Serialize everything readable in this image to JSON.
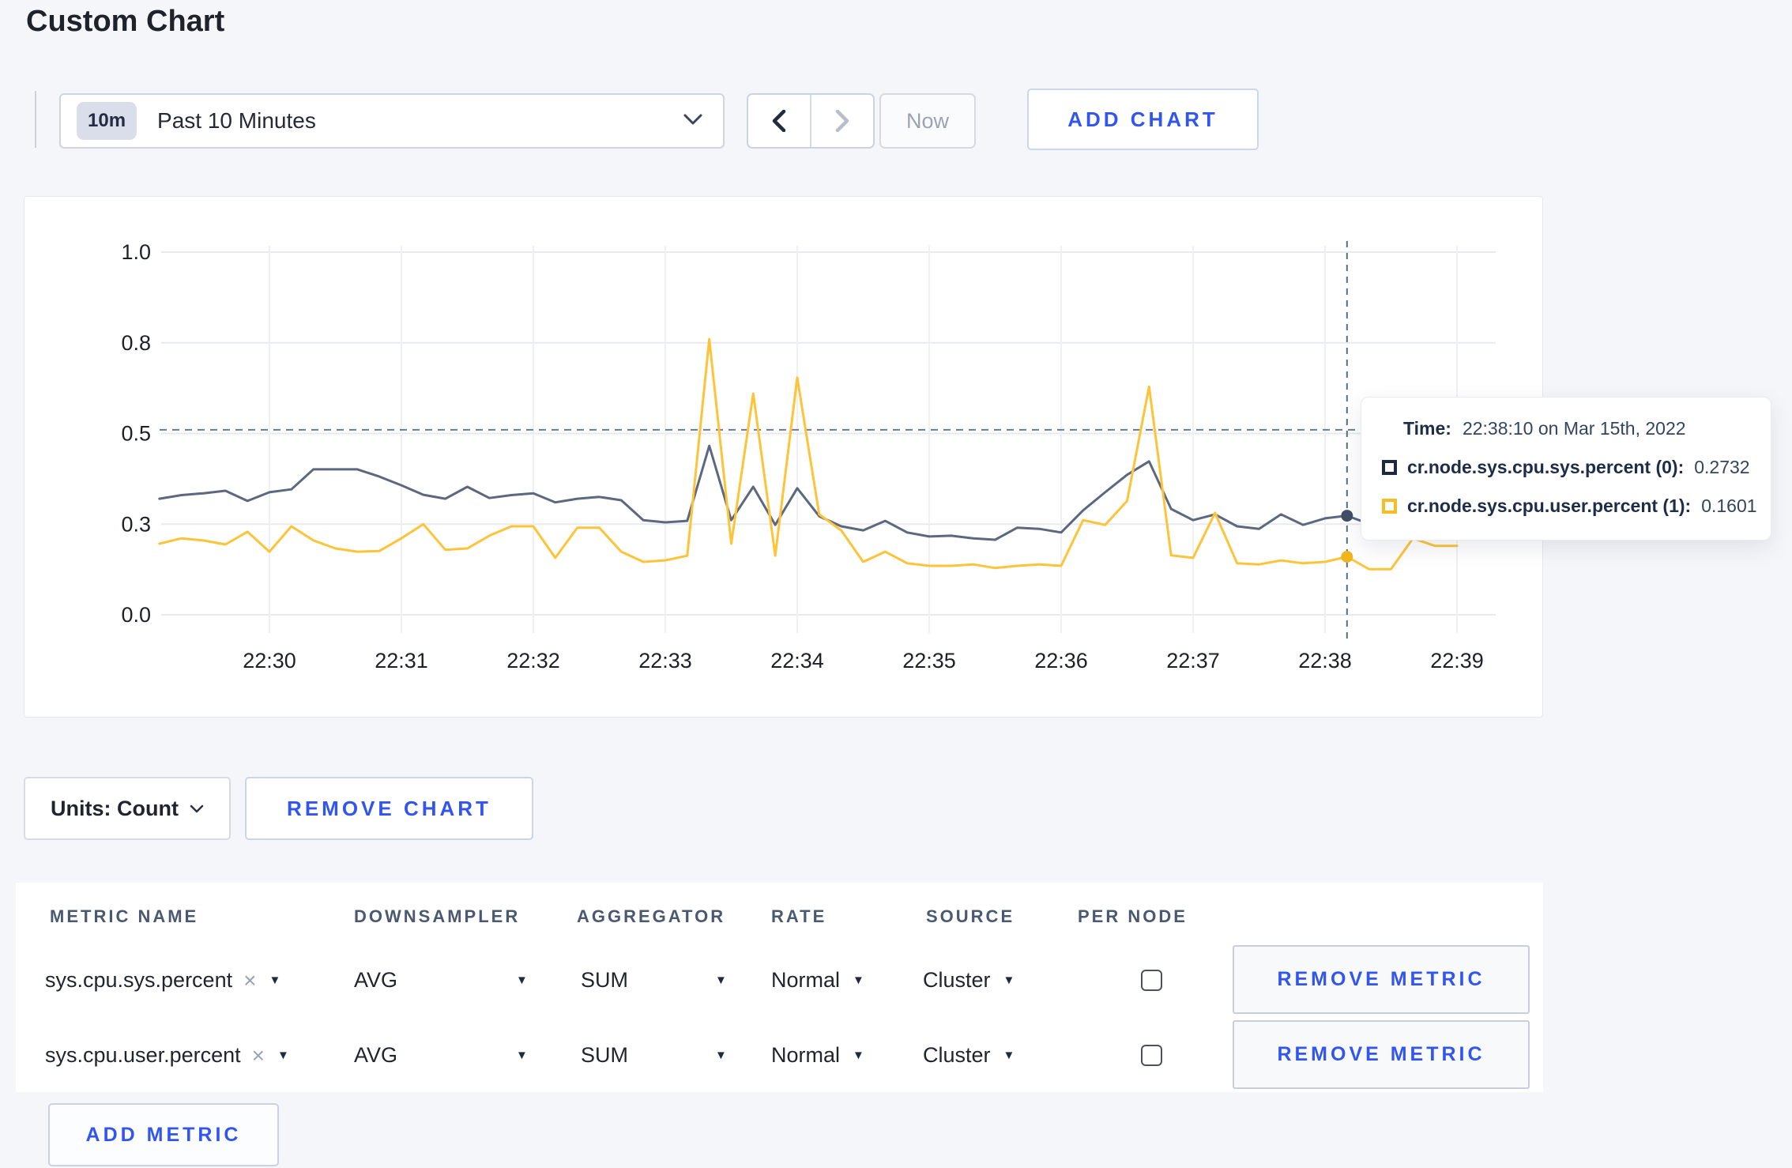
{
  "page": {
    "title": "Custom Chart",
    "accent_blue": "#3155ee",
    "background": "#f5f6fa"
  },
  "toolbar": {
    "time_badge": "10m",
    "time_label": "Past 10 Minutes",
    "now_label": "Now",
    "add_chart_label": "ADD CHART"
  },
  "chart_data": {
    "type": "line",
    "title": "",
    "xlabel": "",
    "ylabel": "",
    "ylim": [
      0,
      1
    ],
    "grid": true,
    "x_seconds_start": 10,
    "x_seconds_step": 10,
    "x_ticks": [
      {
        "seconds": 60,
        "label": "22:30"
      },
      {
        "seconds": 120,
        "label": "22:31"
      },
      {
        "seconds": 180,
        "label": "22:32"
      },
      {
        "seconds": 240,
        "label": "22:33"
      },
      {
        "seconds": 300,
        "label": "22:34"
      },
      {
        "seconds": 360,
        "label": "22:35"
      },
      {
        "seconds": 420,
        "label": "22:36"
      },
      {
        "seconds": 480,
        "label": "22:37"
      },
      {
        "seconds": 540,
        "label": "22:38"
      },
      {
        "seconds": 600,
        "label": "22:39"
      }
    ],
    "y_ticks": [
      {
        "value": 0,
        "label": "0.0"
      },
      {
        "value": 0.25,
        "label": "0.3"
      },
      {
        "value": 0.5,
        "label": "0.5"
      },
      {
        "value": 0.75,
        "label": "0.8"
      },
      {
        "value": 1,
        "label": "1.0"
      }
    ],
    "series": [
      {
        "name": "cr.node.sys.cpu.sys.percent",
        "color": "#5b6880",
        "dot_color": "#414e68",
        "values": [
          0.32,
          0.33,
          0.335,
          0.342,
          0.314,
          0.338,
          0.346,
          0.401,
          0.401,
          0.401,
          0.381,
          0.357,
          0.331,
          0.32,
          0.353,
          0.322,
          0.33,
          0.335,
          0.31,
          0.32,
          0.325,
          0.316,
          0.261,
          0.255,
          0.259,
          0.466,
          0.261,
          0.353,
          0.248,
          0.349,
          0.272,
          0.244,
          0.233,
          0.259,
          0.227,
          0.216,
          0.218,
          0.211,
          0.207,
          0.24,
          0.237,
          0.227,
          0.288,
          0.338,
          0.386,
          0.423,
          0.292,
          0.261,
          0.277,
          0.244,
          0.237,
          0.277,
          0.248,
          0.266,
          0.2732,
          0.251,
          0.247,
          0.252,
          0.262,
          0.27
        ]
      },
      {
        "name": "cr.node.sys.cpu.user.percent",
        "color": "#fdc43a",
        "dot_color": "#f0b41f",
        "values": [
          0.196,
          0.211,
          0.205,
          0.194,
          0.229,
          0.174,
          0.244,
          0.205,
          0.183,
          0.174,
          0.176,
          0.211,
          0.25,
          0.179,
          0.183,
          0.218,
          0.244,
          0.244,
          0.157,
          0.24,
          0.24,
          0.174,
          0.146,
          0.15,
          0.163,
          0.76,
          0.196,
          0.61,
          0.163,
          0.654,
          0.277,
          0.233,
          0.146,
          0.174,
          0.142,
          0.135,
          0.135,
          0.139,
          0.129,
          0.135,
          0.139,
          0.135,
          0.261,
          0.248,
          0.314,
          0.629,
          0.164,
          0.157,
          0.281,
          0.142,
          0.139,
          0.15,
          0.142,
          0.146,
          0.1601,
          0.126,
          0.126,
          0.211,
          0.19,
          0.19
        ]
      }
    ],
    "hover": {
      "x_seconds": 550,
      "guide_value": 0.51
    },
    "legend_position": "tooltip"
  },
  "tooltip": {
    "time_label": "Time:",
    "time_value": "22:38:10 on Mar 15th, 2022",
    "rows": [
      {
        "name": "cr.node.sys.cpu.sys.percent (0):",
        "value": "0.2732",
        "swatch_color": "#1d2940"
      },
      {
        "name": "cr.node.sys.cpu.user.percent (1):",
        "value": "0.1601",
        "swatch_color": "#f5bd26"
      }
    ]
  },
  "chart_footer": {
    "units_label": "Units: Count",
    "remove_chart_label": "REMOVE CHART"
  },
  "metrics_table": {
    "headers": [
      "METRIC NAME",
      "DOWNSAMPLER",
      "AGGREGATOR",
      "RATE",
      "SOURCE",
      "PER NODE"
    ],
    "rows": [
      {
        "metric": "sys.cpu.sys.percent",
        "downsampler": "AVG",
        "aggregator": "SUM",
        "rate": "Normal",
        "source": "Cluster",
        "per_node_checked": false,
        "remove_label": "REMOVE METRIC"
      },
      {
        "metric": "sys.cpu.user.percent",
        "downsampler": "AVG",
        "aggregator": "SUM",
        "rate": "Normal",
        "source": "Cluster",
        "per_node_checked": false,
        "remove_label": "REMOVE METRIC"
      }
    ],
    "add_metric_label": "ADD METRIC"
  }
}
